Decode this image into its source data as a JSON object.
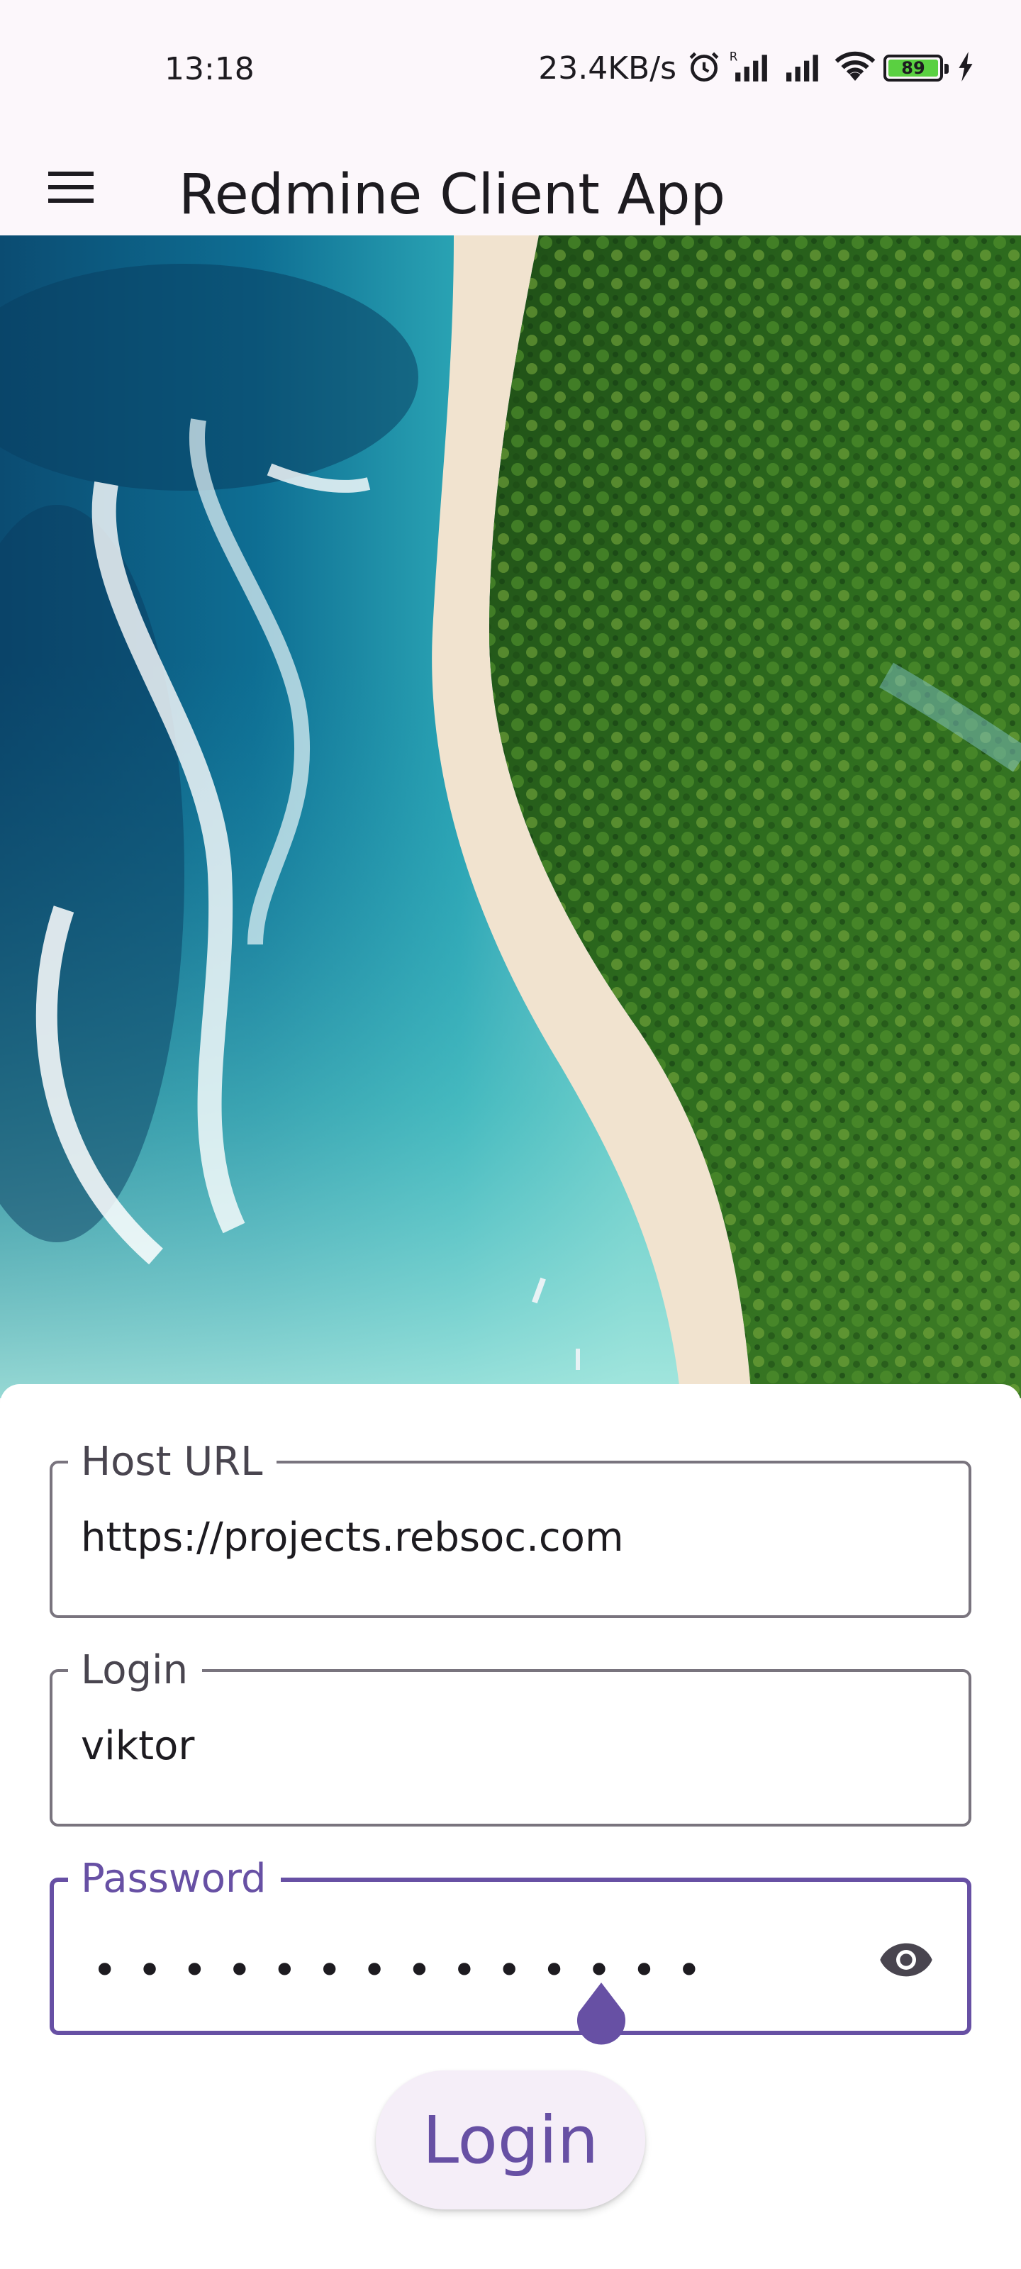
{
  "status_bar": {
    "time": "13:18",
    "net_speed": "23.4KB/s",
    "battery_level": "89",
    "icons": [
      "alarm-icon",
      "signal-r-icon",
      "signal-icon",
      "wifi-icon",
      "battery-icon",
      "charging-icon"
    ]
  },
  "app_bar": {
    "title": "Redmine Client App",
    "menu_icon": "menu-icon"
  },
  "hero": {
    "image": "aerial-beach-palm-forest"
  },
  "form": {
    "host": {
      "label": "Host URL",
      "value": "https://projects.rebsoc.com"
    },
    "login": {
      "label": "Login",
      "value": "viktor"
    },
    "password": {
      "label": "Password",
      "masked_value": "••••••••••••••",
      "visibility_icon": "eye-icon"
    },
    "submit_label": "Login"
  },
  "colors": {
    "primary": "#6750a4",
    "surface": "#fcf7fb",
    "outline": "#79747e",
    "button_bg": "#f5eef8"
  }
}
